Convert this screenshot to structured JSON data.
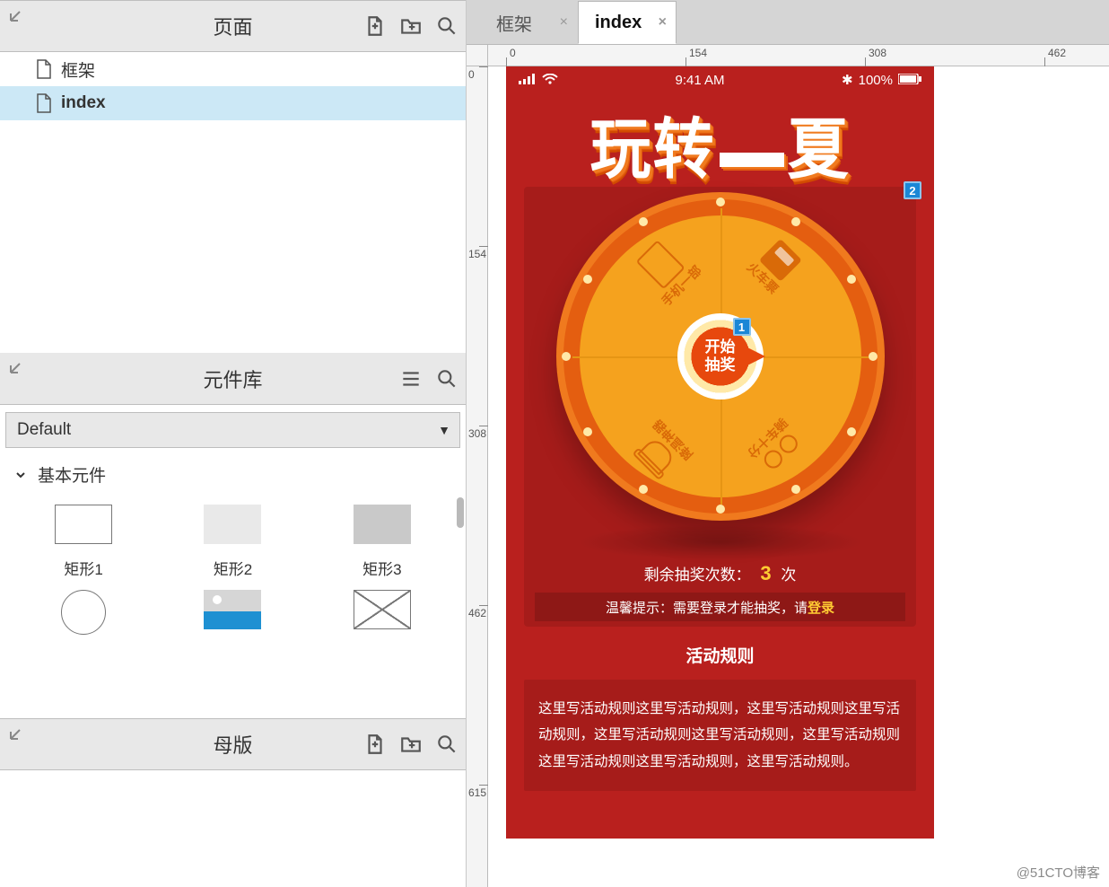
{
  "left": {
    "pages": {
      "title": "页面",
      "items": [
        {
          "label": "框架",
          "selected": false
        },
        {
          "label": "index",
          "selected": true
        }
      ]
    },
    "widgets": {
      "title": "元件库",
      "library": "Default",
      "section": "基本元件",
      "items_row1": [
        {
          "label": "矩形1"
        },
        {
          "label": "矩形2"
        },
        {
          "label": "矩形3"
        }
      ],
      "items_row2": [
        {
          "label": ""
        },
        {
          "label": ""
        },
        {
          "label": ""
        }
      ]
    },
    "masters": {
      "title": "母版"
    }
  },
  "tabs": [
    {
      "label": "框架",
      "active": false
    },
    {
      "label": "index",
      "active": true
    }
  ],
  "ruler_h": [
    "0",
    "154",
    "308",
    "462"
  ],
  "ruler_v": [
    "0",
    "154",
    "308",
    "462",
    "615"
  ],
  "phone": {
    "status": {
      "time": "9:41 AM",
      "battery_text": "100%"
    },
    "hero_a": "玩转",
    "hero_b": "夏",
    "badge1": "1",
    "badge2": "2",
    "wheel_center": "开始\n抽奖",
    "sectors": {
      "top_left": "手机一部",
      "top_right": "火车票",
      "bottom_right": "骑车十分",
      "bottom_left": "降温神器"
    },
    "remain_prefix": "剩余抽奖次数：",
    "remain_count": "3",
    "remain_suffix": "次",
    "tip_prefix": "温馨提示：需要登录才能抽奖，请",
    "tip_login": "登录",
    "rules_title": "活动规则",
    "rules_body": "这里写活动规则这里写活动规则，这里写活动规则这里写活动规则，这里写活动规则这里写活动规则，这里写活动规则这里写活动规则这里写活动规则，这里写活动规则。"
  },
  "watermark": "@51CTO博客"
}
